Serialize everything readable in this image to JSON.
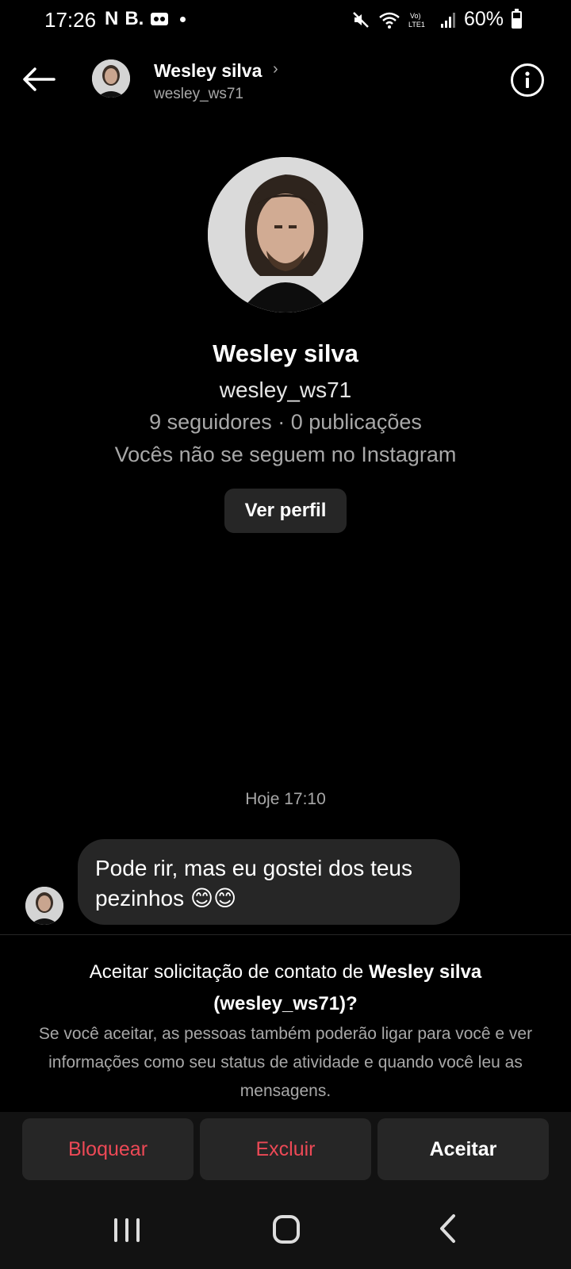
{
  "status_bar": {
    "time": "17:26",
    "left_icons": [
      "N",
      "B."
    ],
    "battery": "60%",
    "icons": [
      "mute-icon",
      "wifi-icon",
      "volte-icon",
      "signal-icon",
      "battery-icon"
    ]
  },
  "header": {
    "name": "Wesley silva",
    "username": "wesley_ws71",
    "chevron": "›"
  },
  "profile": {
    "name": "Wesley silva",
    "username": "wesley_ws71",
    "stats": "9 seguidores · 0 publicações",
    "note": "Vocês não se seguem no Instagram",
    "view_profile_label": "Ver perfil"
  },
  "chat": {
    "timestamp": "Hoje 17:10",
    "message": "Pode rir, mas eu gostei dos teus pezinhos 😊😊"
  },
  "request": {
    "title_prefix": "Aceitar solicitação de contato de ",
    "title_name": "Wesley silva",
    "title_handle": "(wesley_ws71)?",
    "body": "Se você aceitar, as pessoas também poderão ligar para você e ver informações como seu status de atividade e quando você leu as mensagens."
  },
  "actions": {
    "block_label": "Bloquear",
    "delete_label": "Excluir",
    "accept_label": "Aceitar"
  },
  "colors": {
    "background": "#000000",
    "surface": "#262626",
    "secondary_text": "#a8a8a8",
    "danger": "#ed4956"
  }
}
